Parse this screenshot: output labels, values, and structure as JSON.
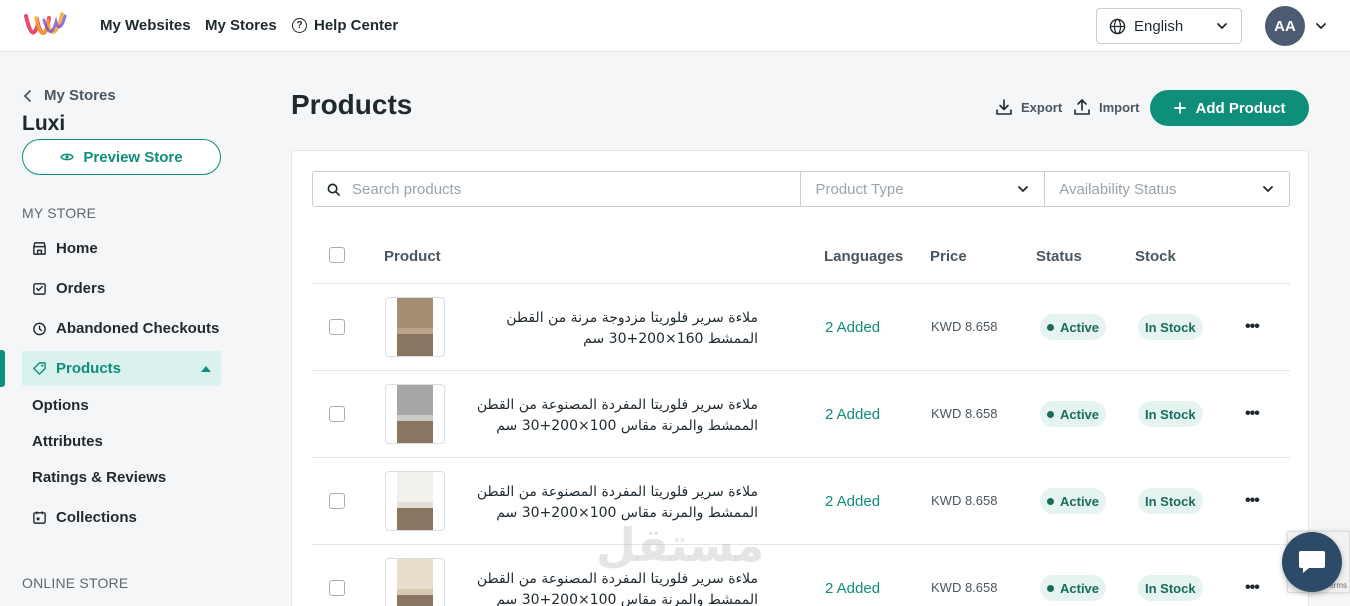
{
  "nav": {
    "my_websites": "My Websites",
    "my_stores": "My Stores",
    "help_center": "Help Center",
    "help_icon_glyph": "?",
    "language": "English",
    "avatar_initials": "AA"
  },
  "sidebar": {
    "back_label": "My Stores",
    "store_name": "Luxi",
    "preview_label": "Preview Store",
    "my_store_title": "MY STORE",
    "items": [
      {
        "label": "Home",
        "icon": "store-icon"
      },
      {
        "label": "Orders",
        "icon": "orders-icon"
      },
      {
        "label": "Abandoned Checkouts",
        "icon": "clock-icon"
      },
      {
        "label": "Products",
        "icon": "tag-icon"
      }
    ],
    "sub_items": [
      "Options",
      "Attributes",
      "Ratings & Reviews"
    ],
    "collections": {
      "label": "Collections",
      "icon": "calendar-icon"
    },
    "online_store_title": "ONLINE STORE"
  },
  "main": {
    "title": "Products",
    "export_label": "Export",
    "import_label": "Import",
    "add_label": "Add Product",
    "search_placeholder": "Search products",
    "product_type_placeholder": "Product Type",
    "availability_placeholder": "Availability Status",
    "columns": {
      "product": "Product",
      "languages": "Languages",
      "price": "Price",
      "status": "Status",
      "stock": "Stock"
    },
    "rows": [
      {
        "name": "ملاءة سرير فلوريتا مزدوجة مرنة من القطن الممشط 160×200+30 سم",
        "languages": "2 Added",
        "price": "KWD 8.658",
        "status": "Active",
        "stock": "In Stock"
      },
      {
        "name": "ملاءة سرير فلوريتا المفردة المصنوعة من القطن الممشط والمرنة مقاس 100×200+30 سم",
        "languages": "2 Added",
        "price": "KWD 8.658",
        "status": "Active",
        "stock": "In Stock"
      },
      {
        "name": "ملاءة سرير فلوريتا المفردة المصنوعة من القطن الممشط والمرنة مقاس 100×200+30 سم",
        "languages": "2 Added",
        "price": "KWD 8.658",
        "status": "Active",
        "stock": "In Stock"
      },
      {
        "name": "ملاءة سرير فلوريتا المفردة المصنوعة من القطن الممشط والمرنة مقاس 100×200+30 سم",
        "languages": "2 Added",
        "price": "KWD 8.658",
        "status": "Active",
        "stock": "In Stock"
      }
    ],
    "more_glyph": "•••"
  },
  "watermark": "مستقل",
  "recaptcha_terms": "Terms",
  "colors": {
    "accent": "#0f8e7a",
    "accent_light": "#d9f2ee",
    "badge_bg": "#e6f4f1",
    "avatar": "#4d5b72",
    "chat": "#2d4a68"
  }
}
